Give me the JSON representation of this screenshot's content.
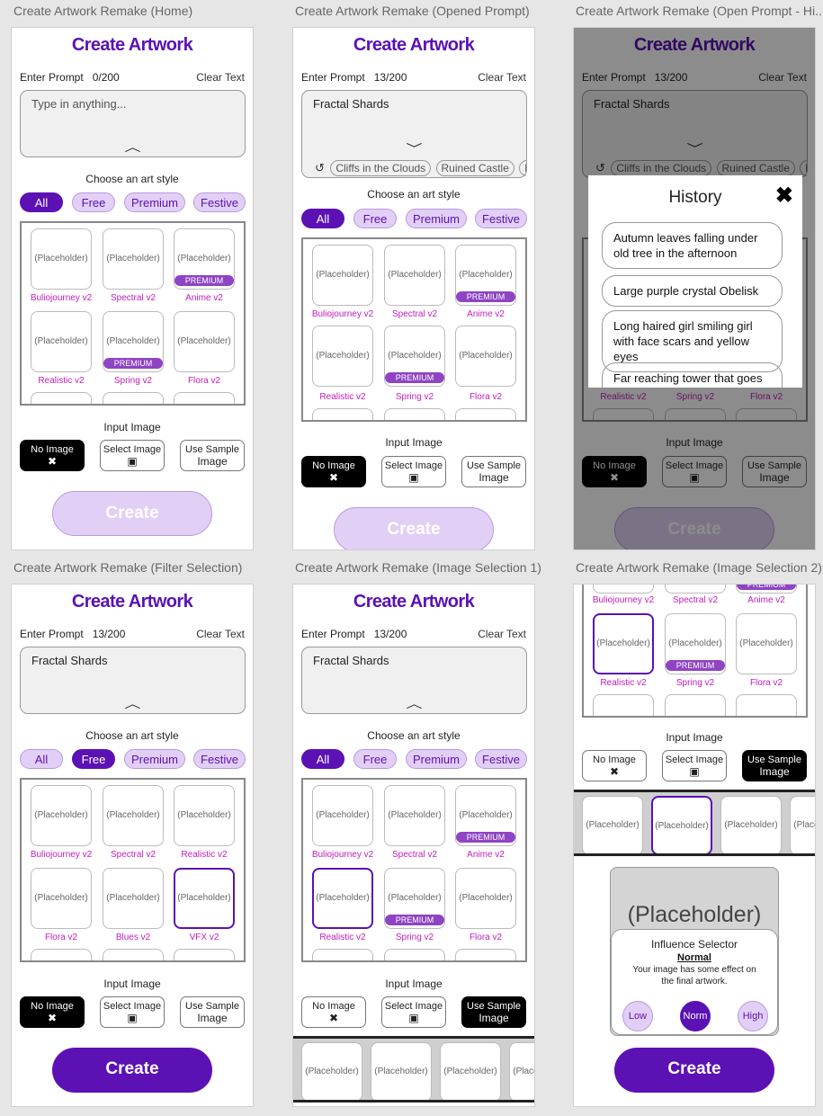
{
  "captions": [
    "Create Artwork Remake (Home)",
    "Create Artwork Remake (Opened Prompt)",
    "Create Artwork Remake (Open Prompt - Hi...",
    "Create Artwork Remake (Filter Selection)",
    "Create Artwork Remake (Image Selection 1)",
    "Create Artwork Remake (Image Selection 2)"
  ],
  "common": {
    "title": "Create Artwork",
    "enter_prompt": "Enter Prompt",
    "clear_text": "Clear Text",
    "choose_style": "Choose an art style",
    "input_image": "Input Image",
    "create": "Create",
    "placeholder": "(Placeholder)",
    "premium": "PREMIUM",
    "tabs": [
      "All",
      "Free",
      "Premium",
      "Festive"
    ],
    "img_btn": {
      "no_image": "No Image",
      "select_image": "Select Image",
      "use_sample_1": "Use Sample",
      "use_sample_2": "Image"
    }
  },
  "f1": {
    "count": "0/200",
    "prompt_placeholder": "Type in anything..."
  },
  "f2": {
    "count": "13/200",
    "prompt_value": "Fractal Shards",
    "history_chips": [
      "Cliffs in the Clouds",
      "Ruined Castle",
      "P"
    ]
  },
  "f3": {
    "history_title": "History",
    "history_items": [
      "Autumn leaves falling under old tree in the afternoon",
      "Large purple crystal Obelisk",
      "Long haired girl smiling girl with face scars and yellow eyes",
      "Far reaching tower that goes up"
    ]
  },
  "styles_all": [
    "Buliojourney v2",
    "Spectral v2",
    "Anime v2",
    "Realistic v2",
    "Spring v2",
    "Flora v2"
  ],
  "styles_free": [
    "Buliojourney v2",
    "Spectral v2",
    "Realistic v2",
    "Flora v2",
    "Blues v2",
    "VFX v2"
  ],
  "influence": {
    "title": "Influence Selector",
    "current": "Normal",
    "desc": "Your image has some effect on the final artwork.",
    "levels": [
      "Low",
      "Norm",
      "High"
    ]
  },
  "colors": {
    "accent": "#5b11b3",
    "accent_light": "#e2cff5",
    "style_label": "#c41cbd",
    "premium_badge": "#8e44c4"
  },
  "icons": {
    "history": "history-icon",
    "close": "close-x-icon",
    "image": "image-icon",
    "chevron": "chevron-icon"
  }
}
